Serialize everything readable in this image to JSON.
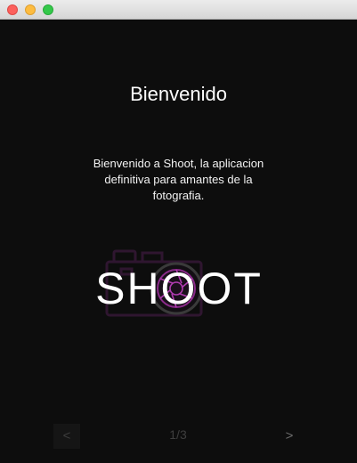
{
  "window": {
    "controls": [
      "close",
      "minimize",
      "maximize"
    ]
  },
  "welcome": {
    "title": "Bienvenido",
    "message": "Bienvenido a Shoot, la aplicacion definitiva para amantes de la fotografia."
  },
  "logo": {
    "wordmark": "SHOOT",
    "icon": "camera-aperture-icon",
    "accent_color": "#8a2a8a",
    "dim_color": "#3a1a3a"
  },
  "pager": {
    "prev_label": "<",
    "next_label": ">",
    "indicator": "1/3"
  }
}
